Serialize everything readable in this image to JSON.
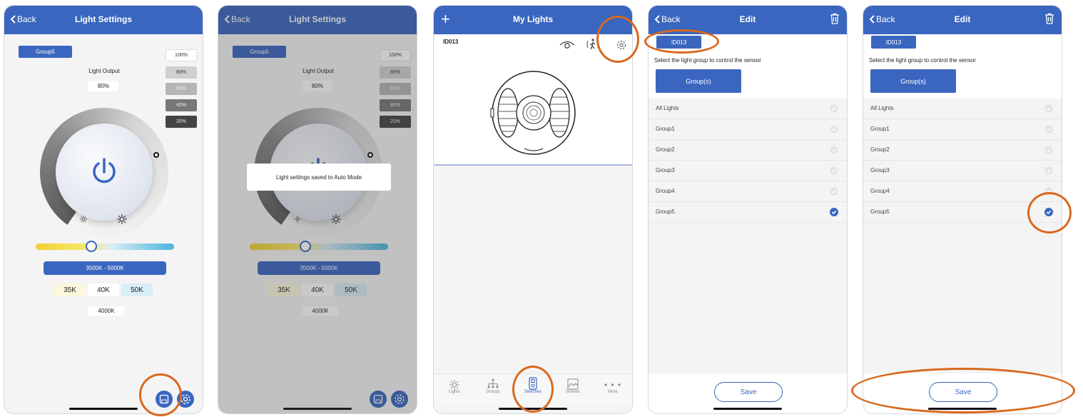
{
  "accent": "#3a66bf",
  "annotation_color": "#d9681e",
  "light_settings": {
    "back": "Back",
    "title": "Light Settings",
    "group_chip": "Group5",
    "percent_options": [
      "100%",
      "80%",
      "60%",
      "40%",
      "20%"
    ],
    "output_label": "Light Output",
    "output_value": "80%",
    "cct_range": "3500K - 5000K",
    "cct_presets": [
      "35K",
      "40K",
      "50K"
    ],
    "cct_value": "4000K",
    "toast": "Light settings saved to Auto Mode",
    "icons": [
      "back-chevron-icon",
      "power-icon",
      "sun-small-icon",
      "sun-large-icon",
      "save-icon",
      "gear-icon"
    ]
  },
  "my_lights": {
    "title": "My Lights",
    "device_id": "ID013",
    "icons": [
      "add-icon",
      "eye-icon",
      "motion-icon",
      "gear-icon"
    ],
    "tabs": [
      {
        "label": "Lights",
        "icon": "light-icon"
      },
      {
        "label": "Groups",
        "icon": "groups-icon"
      },
      {
        "label": "Switches",
        "icon": "switch-icon"
      },
      {
        "label": "Scenes",
        "icon": "scenes-icon"
      },
      {
        "label": "More",
        "icon": "more-icon"
      }
    ],
    "active_tab": "Switches"
  },
  "edit": {
    "back": "Back",
    "title": "Edit",
    "id_chip": "ID013",
    "instruction": "Select the light group to control the sensor",
    "groups_button": "Group(s)",
    "groups": [
      "All Lights",
      "Group1",
      "Group2",
      "Group3",
      "Group4",
      "Group5"
    ],
    "selected": "Group5",
    "save": "Save",
    "icons": [
      "back-chevron-icon",
      "trash-icon",
      "check-icon"
    ]
  }
}
